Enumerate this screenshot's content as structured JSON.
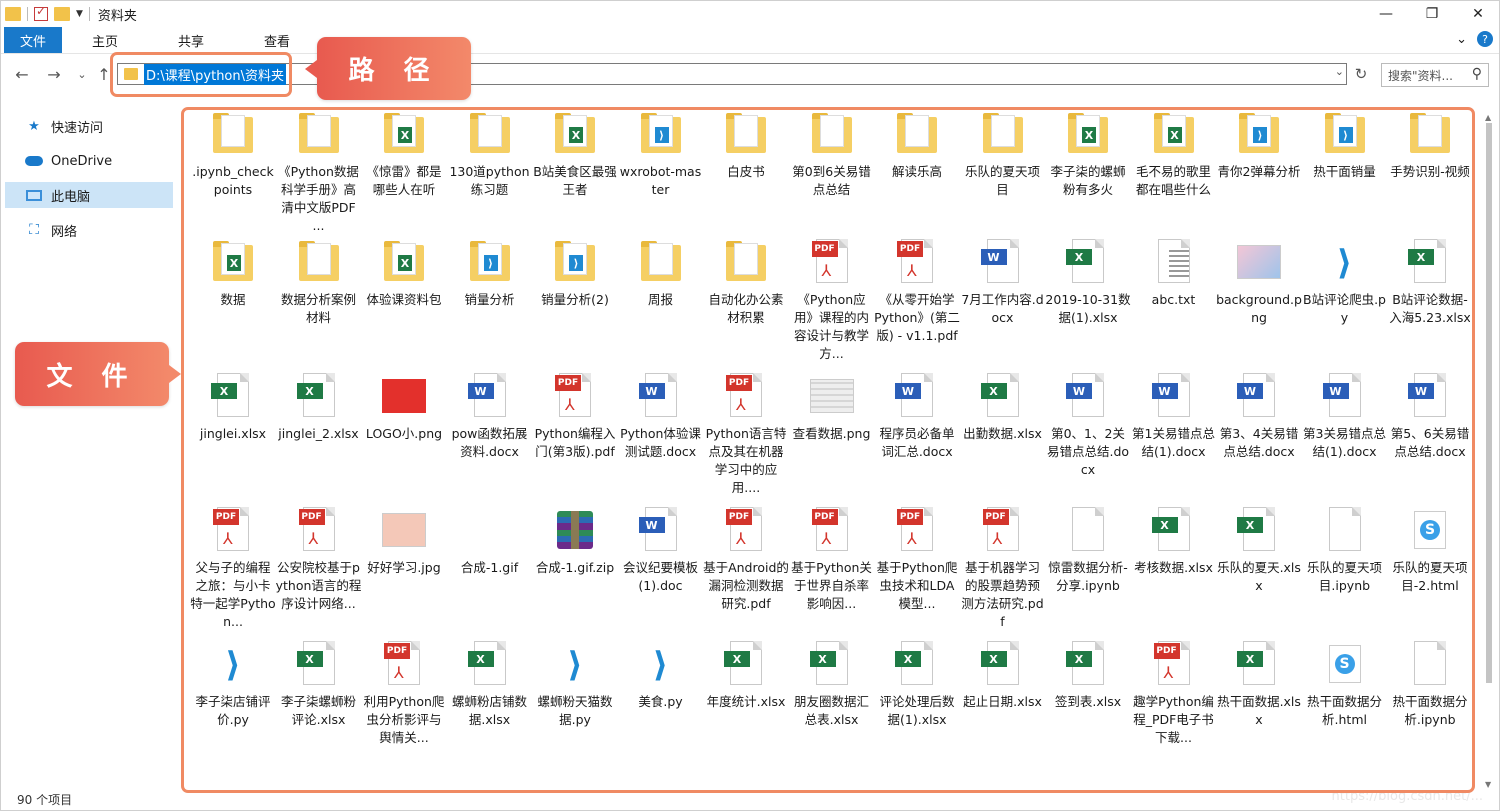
{
  "window": {
    "title": "资料夹",
    "minimize": "—",
    "restore": "❐",
    "close": "✕"
  },
  "ribbon": {
    "tabs": [
      "文件",
      "主页",
      "共享",
      "查看"
    ],
    "expand": "⌄",
    "help": "?"
  },
  "nav": {
    "back": "←",
    "forward": "→",
    "recent": "⌄",
    "up": "↑",
    "refresh": "↻"
  },
  "address": {
    "path": "D:\\课程\\python\\资料夹",
    "dropdown": "⌄"
  },
  "search": {
    "placeholder": "搜索\"资料...",
    "icon": "⚲"
  },
  "callouts": {
    "path": "路 径",
    "files": "文 件"
  },
  "sidebar": {
    "items": [
      {
        "label": "快速访问",
        "icon": "star-icon",
        "glyph": "★"
      },
      {
        "label": "OneDrive",
        "icon": "cloud-icon",
        "glyph": ""
      },
      {
        "label": "此电脑",
        "icon": "computer-icon",
        "glyph": ""
      },
      {
        "label": "网络",
        "icon": "network-icon",
        "glyph": "⛶"
      }
    ]
  },
  "files": [
    {
      "name": ".ipynb_checkpoints",
      "type": "folder"
    },
    {
      "name": "《Python数据科学手册》高清中文版PDF ...",
      "type": "folder"
    },
    {
      "name": "《惊雷》都是哪些人在听",
      "type": "folder-x"
    },
    {
      "name": "130道python练习题",
      "type": "folder"
    },
    {
      "name": "B站美食区最强王者",
      "type": "folder-x"
    },
    {
      "name": "wxrobot-master",
      "type": "folder-vsc"
    },
    {
      "name": "白皮书",
      "type": "folder"
    },
    {
      "name": "第0到6关易错点总结",
      "type": "folder"
    },
    {
      "name": "解读乐高",
      "type": "folder"
    },
    {
      "name": "乐队的夏天项目",
      "type": "folder"
    },
    {
      "name": "李子柒的螺蛳粉有多火",
      "type": "folder-x"
    },
    {
      "name": "毛不易的歌里都在唱些什么",
      "type": "folder-x"
    },
    {
      "name": "青你2弹幕分析",
      "type": "folder-vsc"
    },
    {
      "name": "热干面销量",
      "type": "folder-vsc"
    },
    {
      "name": "手势识别-视频",
      "type": "folder"
    },
    {
      "name": "数据",
      "type": "folder-x"
    },
    {
      "name": "数据分析案例材料",
      "type": "folder"
    },
    {
      "name": "体验课资料包",
      "type": "folder-x"
    },
    {
      "name": "销量分析",
      "type": "folder-vsc"
    },
    {
      "name": "销量分析(2)",
      "type": "folder-vsc"
    },
    {
      "name": "周报",
      "type": "folder"
    },
    {
      "name": "自动化办公素材积累",
      "type": "folder"
    },
    {
      "name": "《Python应用》课程的内容设计与教学方...",
      "type": "pdf"
    },
    {
      "name": "《从零开始学 Python》(第二版) - v1.1.pdf",
      "type": "pdf"
    },
    {
      "name": "7月工作内容.docx",
      "type": "word"
    },
    {
      "name": "2019-10-31数据(1).xlsx",
      "type": "excel"
    },
    {
      "name": "abc.txt",
      "type": "txt"
    },
    {
      "name": "background.png",
      "type": "image"
    },
    {
      "name": "B站评论爬虫.py",
      "type": "vsc"
    },
    {
      "name": "B站评论数据-入海5.23.xlsx",
      "type": "excel"
    },
    {
      "name": "jinglei.xlsx",
      "type": "excel"
    },
    {
      "name": "jinglei_2.xlsx",
      "type": "excel"
    },
    {
      "name": "LOGO小.png",
      "type": "image-red"
    },
    {
      "name": "pow函数拓展资料.docx",
      "type": "word"
    },
    {
      "name": "Python编程入门(第3版).pdf",
      "type": "pdf"
    },
    {
      "name": "Python体验课测试题.docx",
      "type": "word"
    },
    {
      "name": "Python语言特点及其在机器学习中的应用....",
      "type": "pdf"
    },
    {
      "name": "查看数据.png",
      "type": "image-gray"
    },
    {
      "name": "程序员必备单词汇总.docx",
      "type": "word"
    },
    {
      "name": "出勤数据.xlsx",
      "type": "excel"
    },
    {
      "name": "第0、1、2关易错点总结.docx",
      "type": "word"
    },
    {
      "name": "第1关易错点总结(1).docx",
      "type": "word"
    },
    {
      "name": "第3、4关易错点总结.docx",
      "type": "word"
    },
    {
      "name": "第3关易错点总结(1).docx",
      "type": "word"
    },
    {
      "name": "第5、6关易错点总结.docx",
      "type": "word"
    },
    {
      "name": "父与子的编程之旅：与小卡特一起学Python...",
      "type": "pdf"
    },
    {
      "name": "公安院校基于python语言的程序设计网络...",
      "type": "pdf"
    },
    {
      "name": "好好学习.jpg",
      "type": "image-pink"
    },
    {
      "name": "合成-1.gif",
      "type": "blank"
    },
    {
      "name": "合成-1.gif.zip",
      "type": "zip"
    },
    {
      "name": "会议纪要模板(1).doc",
      "type": "word"
    },
    {
      "name": "基于Android的漏洞检测数据研究.pdf",
      "type": "pdf"
    },
    {
      "name": "基于Python关于世界自杀率影响因...",
      "type": "pdf"
    },
    {
      "name": "基于Python爬虫技术和LDA模型...",
      "type": "pdf"
    },
    {
      "name": "基于机器学习的股票趋势预测方法研究.pdf",
      "type": "pdf"
    },
    {
      "name": "惊雷数据分析-分享.ipynb",
      "type": "page"
    },
    {
      "name": "考核数据.xlsx",
      "type": "excel"
    },
    {
      "name": "乐队的夏天.xlsx",
      "type": "excel"
    },
    {
      "name": "乐队的夏天项目.ipynb",
      "type": "page"
    },
    {
      "name": "乐队的夏天项目-2.html",
      "type": "html"
    },
    {
      "name": "李子柒店铺评价.py",
      "type": "vsc"
    },
    {
      "name": "李子柒螺蛳粉评论.xlsx",
      "type": "excel"
    },
    {
      "name": "利用Python爬虫分析影评与舆情关...",
      "type": "pdf"
    },
    {
      "name": "螺蛳粉店铺数据.xlsx",
      "type": "excel"
    },
    {
      "name": "螺蛳粉天猫数据.py",
      "type": "vsc"
    },
    {
      "name": "美食.py",
      "type": "vsc"
    },
    {
      "name": "年度统计.xlsx",
      "type": "excel"
    },
    {
      "name": "朋友圈数据汇总表.xlsx",
      "type": "excel"
    },
    {
      "name": "评论处理后数据(1).xlsx",
      "type": "excel"
    },
    {
      "name": "起止日期.xlsx",
      "type": "excel"
    },
    {
      "name": "签到表.xlsx",
      "type": "excel"
    },
    {
      "name": "趣学Python编程_PDF电子书下载...",
      "type": "pdf"
    },
    {
      "name": "热干面数据.xlsx",
      "type": "excel"
    },
    {
      "name": "热干面数据分析.html",
      "type": "html"
    },
    {
      "name": "热干面数据分析.ipynb",
      "type": "page"
    }
  ],
  "status": {
    "count": "90 个项目"
  },
  "watermark": "https://blog.csdn.net/..."
}
